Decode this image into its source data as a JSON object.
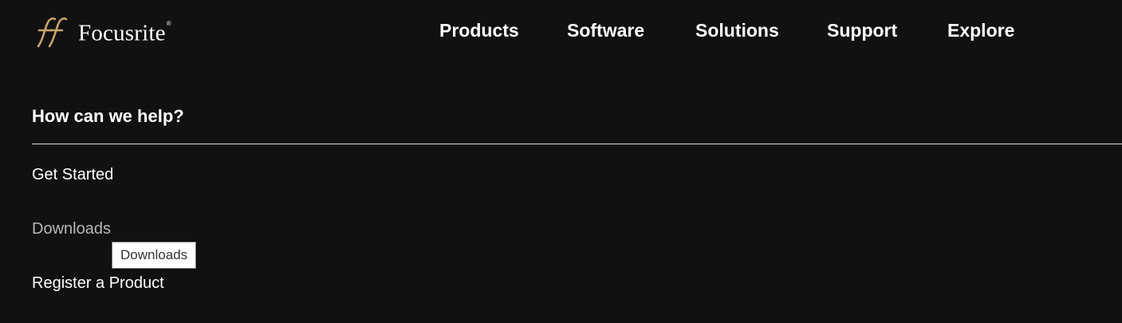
{
  "brand": {
    "name": "Focusrite",
    "registered_mark": "®",
    "accent_color": "#c9a36a"
  },
  "nav": {
    "items": [
      {
        "label": "Products"
      },
      {
        "label": "Software"
      },
      {
        "label": "Solutions"
      },
      {
        "label": "Support"
      },
      {
        "label": "Explore"
      }
    ]
  },
  "help": {
    "heading": "How can we help?",
    "links": [
      {
        "label": "Get Started"
      },
      {
        "label": "Downloads",
        "state": "hovered"
      },
      {
        "label": "Register a Product"
      }
    ]
  },
  "tooltip": {
    "text": "Downloads"
  },
  "colors": {
    "background": "#111111",
    "text": "#ffffff",
    "hover_text": "#b7b7b7",
    "divider": "#d9d9d9"
  }
}
